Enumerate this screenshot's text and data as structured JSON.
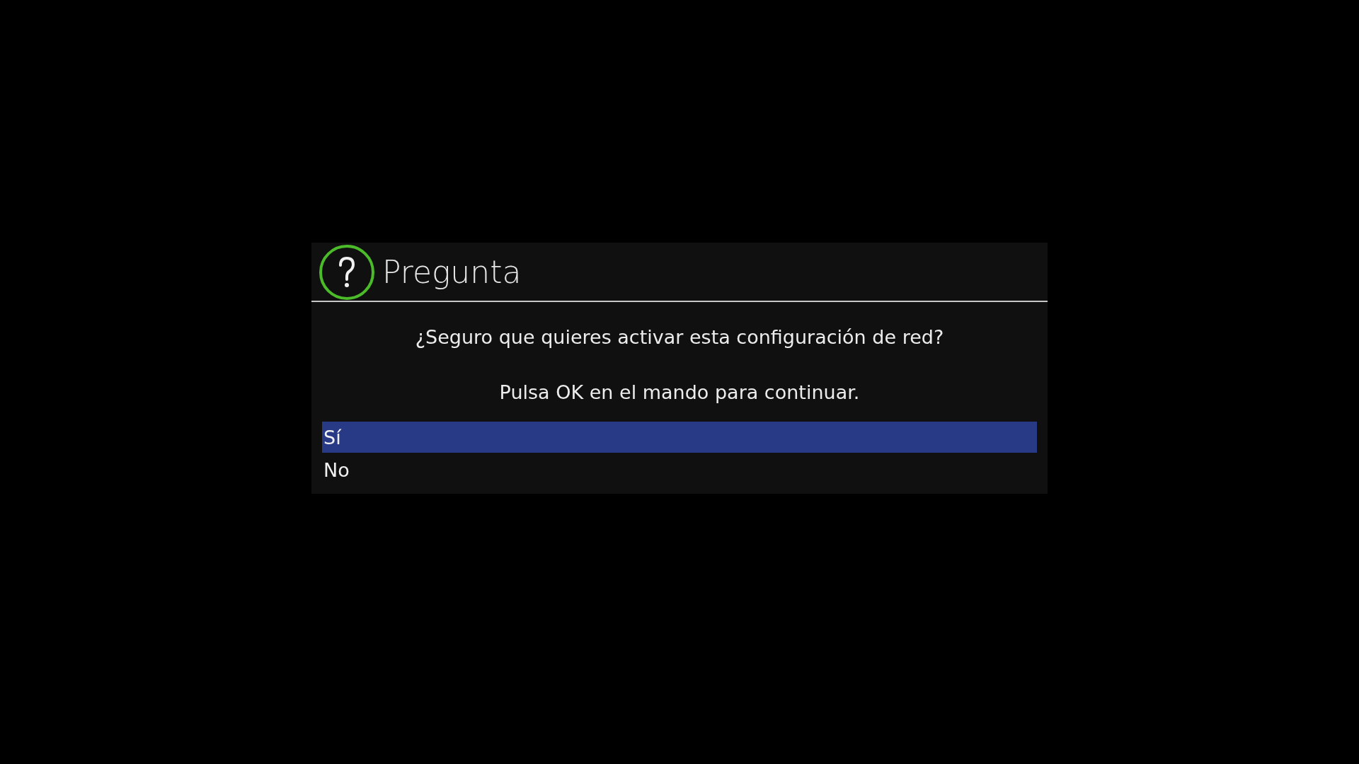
{
  "dialog": {
    "title": "Pregunta",
    "messages": [
      "¿Seguro que quieres activar esta configuración de red?",
      "Pulsa OK en el mando para continuar."
    ],
    "options": [
      {
        "label": "Sí",
        "selected": true
      },
      {
        "label": "No",
        "selected": false
      }
    ]
  }
}
